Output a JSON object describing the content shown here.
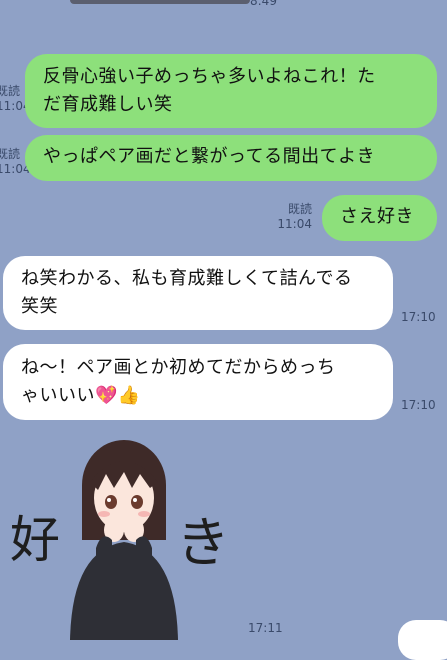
{
  "top_partial_time": "8:49",
  "messages": [
    {
      "kind": "out",
      "text_line1": "反骨心強い子めっちゃ多いよねこれ！た",
      "text_line2": "だ育成難しい笑",
      "read": "既読",
      "time": "11:04"
    },
    {
      "kind": "out",
      "text": "やっぱペア画だと繋がってる間出てよき",
      "read": "既読",
      "time": "11:04"
    },
    {
      "kind": "out",
      "text": "さえ好き",
      "read": "既読",
      "time": "11:04"
    },
    {
      "kind": "in",
      "text_line1": "ね笑わかる、私も育成難しくて詰んでる",
      "text_line2": "笑笑",
      "time": "17:10"
    },
    {
      "kind": "in",
      "text_line1": "ね〜！ペア画とか初めてだからめっち",
      "text_line2": "ゃいいい",
      "emoji": [
        "💖",
        "👍"
      ],
      "time": "17:10"
    }
  ],
  "sticker": {
    "left_char": "好",
    "right_char": "き",
    "time": "17:11"
  },
  "colors": {
    "background": "#8fa1c6",
    "outgoing": "#8de07b",
    "incoming": "#ffffff"
  }
}
